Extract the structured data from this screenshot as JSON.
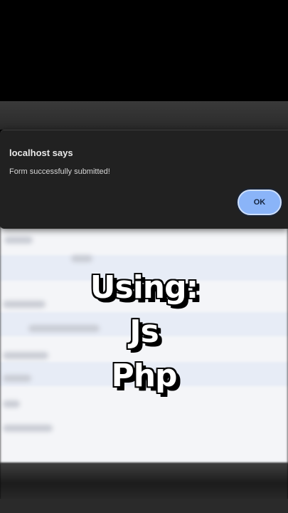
{
  "dialog": {
    "title": "localhost says",
    "message": "Form successfully submitted!",
    "ok_label": "OK"
  },
  "overlay": {
    "line1": "Using:",
    "line2": "Js",
    "line3": "Php"
  },
  "colors": {
    "dialog_bg": "#212121",
    "ok_button": "#8ab4f8",
    "caption_text": "#ffffff"
  }
}
